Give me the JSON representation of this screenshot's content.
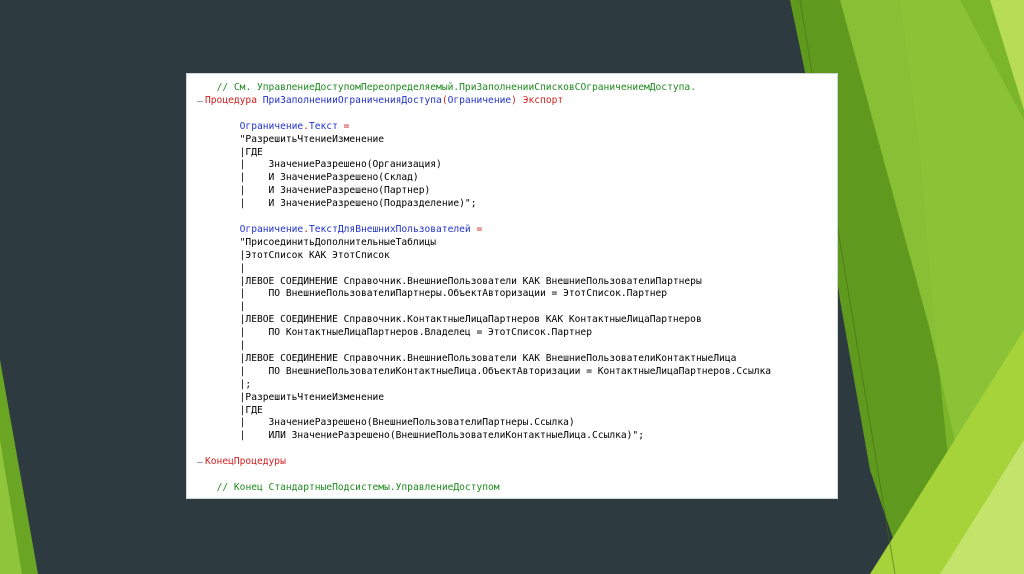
{
  "colors": {
    "background": "#2d3a3f",
    "comment": "#1f8a1f",
    "keyword": "#d42020",
    "identifier": "#2233cc",
    "text": "#000000",
    "green_light": "#a6d23a",
    "green_dark": "#5f9a1f"
  },
  "code": {
    "lines": [
      {
        "indent": "  ",
        "parts": [
          {
            "t": "// См. УправлениеДоступомПереопределяемый.ПриЗаполненииСписковСОграничениемДоступа.",
            "c": "comment"
          }
        ]
      },
      {
        "indent": "",
        "parts": [
          {
            "t": "Процедура ",
            "c": "kw"
          },
          {
            "t": "ПриЗаполненииОграниченияДоступа",
            "c": "ident"
          },
          {
            "t": "(",
            "c": "op"
          },
          {
            "t": "Ограничение",
            "c": "ident"
          },
          {
            "t": ") ",
            "c": "op"
          },
          {
            "t": "Экспорт",
            "c": "kw"
          }
        ]
      },
      {
        "indent": "",
        "parts": []
      },
      {
        "indent": "      ",
        "parts": [
          {
            "t": "Ограничение",
            "c": "ident"
          },
          {
            "t": ".",
            "c": "op"
          },
          {
            "t": "Текст",
            "c": "ident"
          },
          {
            "t": " =",
            "c": "op"
          }
        ]
      },
      {
        "indent": "      ",
        "parts": [
          {
            "t": "\"РазрешитьЧтениеИзменение",
            "c": "str"
          }
        ]
      },
      {
        "indent": "      ",
        "parts": [
          {
            "t": "|ГДЕ",
            "c": "str"
          }
        ]
      },
      {
        "indent": "      ",
        "parts": [
          {
            "t": "|    ЗначениеРазрешено(Организация)",
            "c": "str"
          }
        ]
      },
      {
        "indent": "      ",
        "parts": [
          {
            "t": "|    И ЗначениеРазрешено(Склад)",
            "c": "str"
          }
        ]
      },
      {
        "indent": "      ",
        "parts": [
          {
            "t": "|    И ЗначениеРазрешено(Партнер)",
            "c": "str"
          }
        ]
      },
      {
        "indent": "      ",
        "parts": [
          {
            "t": "|    И ЗначениеРазрешено(Подразделение)\";",
            "c": "str"
          }
        ]
      },
      {
        "indent": "",
        "parts": []
      },
      {
        "indent": "      ",
        "parts": [
          {
            "t": "Ограничение",
            "c": "ident"
          },
          {
            "t": ".",
            "c": "op"
          },
          {
            "t": "ТекстДляВнешнихПользователей",
            "c": "ident"
          },
          {
            "t": " =",
            "c": "op"
          }
        ]
      },
      {
        "indent": "      ",
        "parts": [
          {
            "t": "\"ПрисоединитьДополнительныеТаблицы",
            "c": "str"
          }
        ]
      },
      {
        "indent": "      ",
        "parts": [
          {
            "t": "|ЭтотСписок КАК ЭтотСписок",
            "c": "str"
          }
        ]
      },
      {
        "indent": "      ",
        "parts": [
          {
            "t": "|",
            "c": "str"
          }
        ]
      },
      {
        "indent": "      ",
        "parts": [
          {
            "t": "|ЛЕВОЕ СОЕДИНЕНИЕ Справочник.ВнешниеПользователи КАК ВнешниеПользователиПартнеры",
            "c": "str"
          }
        ]
      },
      {
        "indent": "      ",
        "parts": [
          {
            "t": "|    ПО ВнешниеПользователиПартнеры.ОбъектАвторизации = ЭтотСписок.Партнер",
            "c": "str"
          }
        ]
      },
      {
        "indent": "      ",
        "parts": [
          {
            "t": "|",
            "c": "str"
          }
        ]
      },
      {
        "indent": "      ",
        "parts": [
          {
            "t": "|ЛЕВОЕ СОЕДИНЕНИЕ Справочник.КонтактныеЛицаПартнеров КАК КонтактныеЛицаПартнеров",
            "c": "str"
          }
        ]
      },
      {
        "indent": "      ",
        "parts": [
          {
            "t": "|    ПО КонтактныеЛицаПартнеров.Владелец = ЭтотСписок.Партнер",
            "c": "str"
          }
        ]
      },
      {
        "indent": "      ",
        "parts": [
          {
            "t": "|",
            "c": "str"
          }
        ]
      },
      {
        "indent": "      ",
        "parts": [
          {
            "t": "|ЛЕВОЕ СОЕДИНЕНИЕ Справочник.ВнешниеПользователи КАК ВнешниеПользователиКонтактныеЛица",
            "c": "str"
          }
        ]
      },
      {
        "indent": "      ",
        "parts": [
          {
            "t": "|    ПО ВнешниеПользователиКонтактныеЛица.ОбъектАвторизации = КонтактныеЛицаПартнеров.Ссылка",
            "c": "str"
          }
        ]
      },
      {
        "indent": "      ",
        "parts": [
          {
            "t": "|;",
            "c": "str"
          }
        ]
      },
      {
        "indent": "      ",
        "parts": [
          {
            "t": "|РазрешитьЧтениеИзменение",
            "c": "str"
          }
        ]
      },
      {
        "indent": "      ",
        "parts": [
          {
            "t": "|ГДЕ",
            "c": "str"
          }
        ]
      },
      {
        "indent": "      ",
        "parts": [
          {
            "t": "|    ЗначениеРазрешено(ВнешниеПользователиПартнеры.Ссылка)",
            "c": "str"
          }
        ]
      },
      {
        "indent": "      ",
        "parts": [
          {
            "t": "|    ИЛИ ЗначениеРазрешено(ВнешниеПользователиКонтактныеЛица.Ссылка)\";",
            "c": "str"
          }
        ]
      },
      {
        "indent": "",
        "parts": []
      },
      {
        "indent": "",
        "parts": [
          {
            "t": "КонецПроцедуры",
            "c": "kw"
          }
        ]
      },
      {
        "indent": "",
        "parts": []
      },
      {
        "indent": "  ",
        "parts": [
          {
            "t": "// Конец СтандартныеПодсистемы.УправлениеДоступом",
            "c": "comment"
          }
        ]
      }
    ]
  }
}
